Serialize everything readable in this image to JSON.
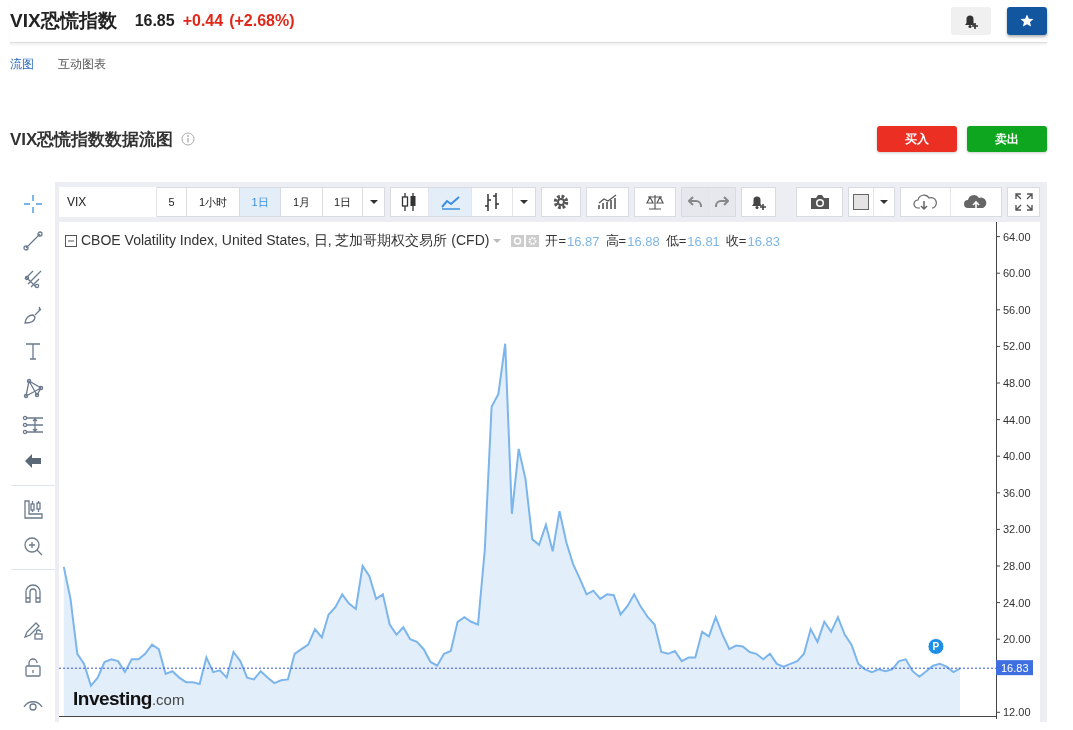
{
  "header": {
    "title": "VIX恐慌指数",
    "price": "16.85",
    "change": "+0.44",
    "change_percent": "(+2.68%)"
  },
  "tabs": [
    {
      "label": "流图",
      "selected": true
    },
    {
      "label": "互动图表",
      "selected": false
    }
  ],
  "section": {
    "title": "VIX恐慌指数数据流图",
    "buttons": [
      {
        "label": "买入",
        "kind": "buy"
      },
      {
        "label": "卖出",
        "kind": "sell"
      }
    ]
  },
  "toolbar": {
    "symbol": "VIX",
    "intervals": [
      {
        "label": "5",
        "selected": false
      },
      {
        "label": "1小时",
        "selected": false
      },
      {
        "label": "1日",
        "selected": true
      },
      {
        "label": "1月",
        "selected": false
      },
      {
        "label": "1日",
        "selected": false
      }
    ],
    "chart_types": [
      {
        "kind": "candles",
        "selected": false
      },
      {
        "kind": "line",
        "selected": true
      },
      {
        "kind": "bars",
        "selected": false
      }
    ],
    "undo": {
      "disabled": true
    },
    "redo": {
      "disabled": true
    }
  },
  "legend": {
    "title": "CBOE Volatility Index, United States, 日, 芝加哥期权交易所 (CFD)",
    "values": [
      {
        "label": "开=",
        "value": "16.87"
      },
      {
        "label": "高=",
        "value": "16.88"
      },
      {
        "label": "低=",
        "value": "16.81"
      },
      {
        "label": "收=",
        "value": "16.83"
      }
    ]
  },
  "logo": {
    "name": "Investing",
    "suffix": ".com"
  },
  "chart_data": {
    "type": "area",
    "series": [
      {
        "color": "#7cb5ec",
        "values": [
          27.9,
          24.4,
          18.4,
          17.3,
          14.9,
          15.8,
          17.5,
          17.8,
          17.6,
          16.4,
          17.8,
          17.8,
          18.4,
          19.4,
          18.9,
          16.2,
          16.5,
          15.8,
          15.3,
          15.3,
          15.1,
          18.0,
          16.4,
          16.6,
          15.8,
          18.6,
          17.6,
          15.8,
          15.6,
          16.5,
          15.8,
          15.2,
          15.5,
          15.6,
          18.4,
          18.9,
          19.4,
          21.1,
          20.2,
          22.7,
          23.5,
          24.9,
          23.9,
          23.3,
          28.0,
          26.9,
          24.4,
          24.9,
          21.6,
          20.5,
          21.3,
          20.0,
          19.7,
          18.9,
          17.5,
          17.1,
          18.4,
          18.7,
          21.9,
          22.4,
          21.9,
          21.6,
          29.8,
          45.4,
          46.8,
          52.3,
          33.7,
          40.8,
          37.5,
          30.9,
          30.3,
          32.5,
          29.6,
          34.0,
          30.6,
          28.2,
          26.6,
          24.9,
          25.3,
          24.4,
          24.9,
          24.8,
          22.7,
          23.6,
          24.9,
          23.5,
          22.4,
          21.6,
          18.6,
          18.4,
          18.7,
          17.6,
          18.0,
          18.0,
          20.8,
          20.3,
          22.4,
          20.5,
          18.9,
          19.3,
          19.2,
          18.6,
          18.4,
          17.8,
          18.4,
          17.3,
          17.0,
          17.3,
          17.6,
          18.4,
          21.1,
          19.7,
          21.9,
          20.8,
          22.4,
          20.5,
          19.4,
          17.3,
          16.7,
          16.4,
          16.7,
          16.5,
          16.7,
          17.6,
          17.8,
          16.5,
          15.9,
          16.5,
          17.1,
          17.3,
          17.0,
          16.4,
          16.8
        ]
      }
    ],
    "ylim": [
      11.6,
      65.6
    ],
    "yticks": [
      {
        "value": 12,
        "label": "12.00"
      },
      {
        "value": 20,
        "label": "20.00"
      },
      {
        "value": 24,
        "label": "24.00"
      },
      {
        "value": 28,
        "label": "28.00"
      },
      {
        "value": 32,
        "label": "32.00"
      },
      {
        "value": 36,
        "label": "36.00"
      },
      {
        "value": 40,
        "label": "40.00"
      },
      {
        "value": 44,
        "label": "44.00"
      },
      {
        "value": 48,
        "label": "48.00"
      },
      {
        "value": 52,
        "label": "52.00"
      },
      {
        "value": 56,
        "label": "56.00"
      },
      {
        "value": 60,
        "label": "60.00"
      },
      {
        "value": 64,
        "label": "64.00"
      }
    ],
    "ref_lines": [
      {
        "axis": "y",
        "value": 16.83,
        "label": "16.83"
      }
    ],
    "annotations": [
      {
        "y": 19.2,
        "text": "P"
      }
    ]
  }
}
